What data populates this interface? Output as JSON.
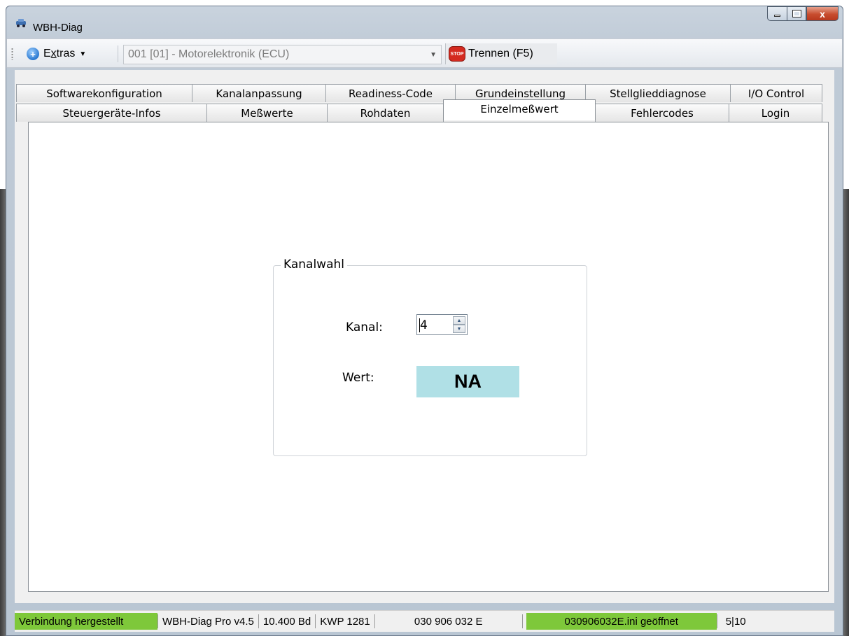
{
  "window": {
    "title": "WBH-Diag",
    "close_glyph": "x"
  },
  "toolbar": {
    "extras_prefix": "E",
    "extras_underlined": "x",
    "extras_suffix": "tras",
    "module_select_value": "001 [01] - Motorelektronik (ECU)",
    "disconnect_label": "Trennen (F5)",
    "stop_icon_text": "STOP"
  },
  "tabs": {
    "row1": [
      "Softwarekonfiguration",
      "Kanalanpassung",
      "Readiness-Code",
      "Grundeinstellung",
      "Stellglieddiagnose",
      "I/O Control"
    ],
    "row2": [
      "Steuergeräte-Infos",
      "Meßwerte",
      "Rohdaten",
      "Einzelmeßwert",
      "Fehlercodes",
      "Login"
    ],
    "active": "Einzelmeßwert"
  },
  "kanalwahl": {
    "group_title": "Kanalwahl",
    "kanal_label": "Kanal:",
    "kanal_value": "4",
    "wert_label": "Wert:",
    "wert_value": "NA"
  },
  "statusbar": {
    "connection": "Verbindung hergestellt",
    "version": "WBH-Diag Pro v4.5",
    "baud": "10.400 Bd",
    "protocol": "KWP 1281",
    "part_number": "030 906 032 E",
    "ini_status": "030906032E.ini geöffnet",
    "counter": "5|10"
  },
  "colors": {
    "status_green": "#7ec83a",
    "value_box": "#b0e0e6",
    "stop_red": "#d42a20"
  }
}
